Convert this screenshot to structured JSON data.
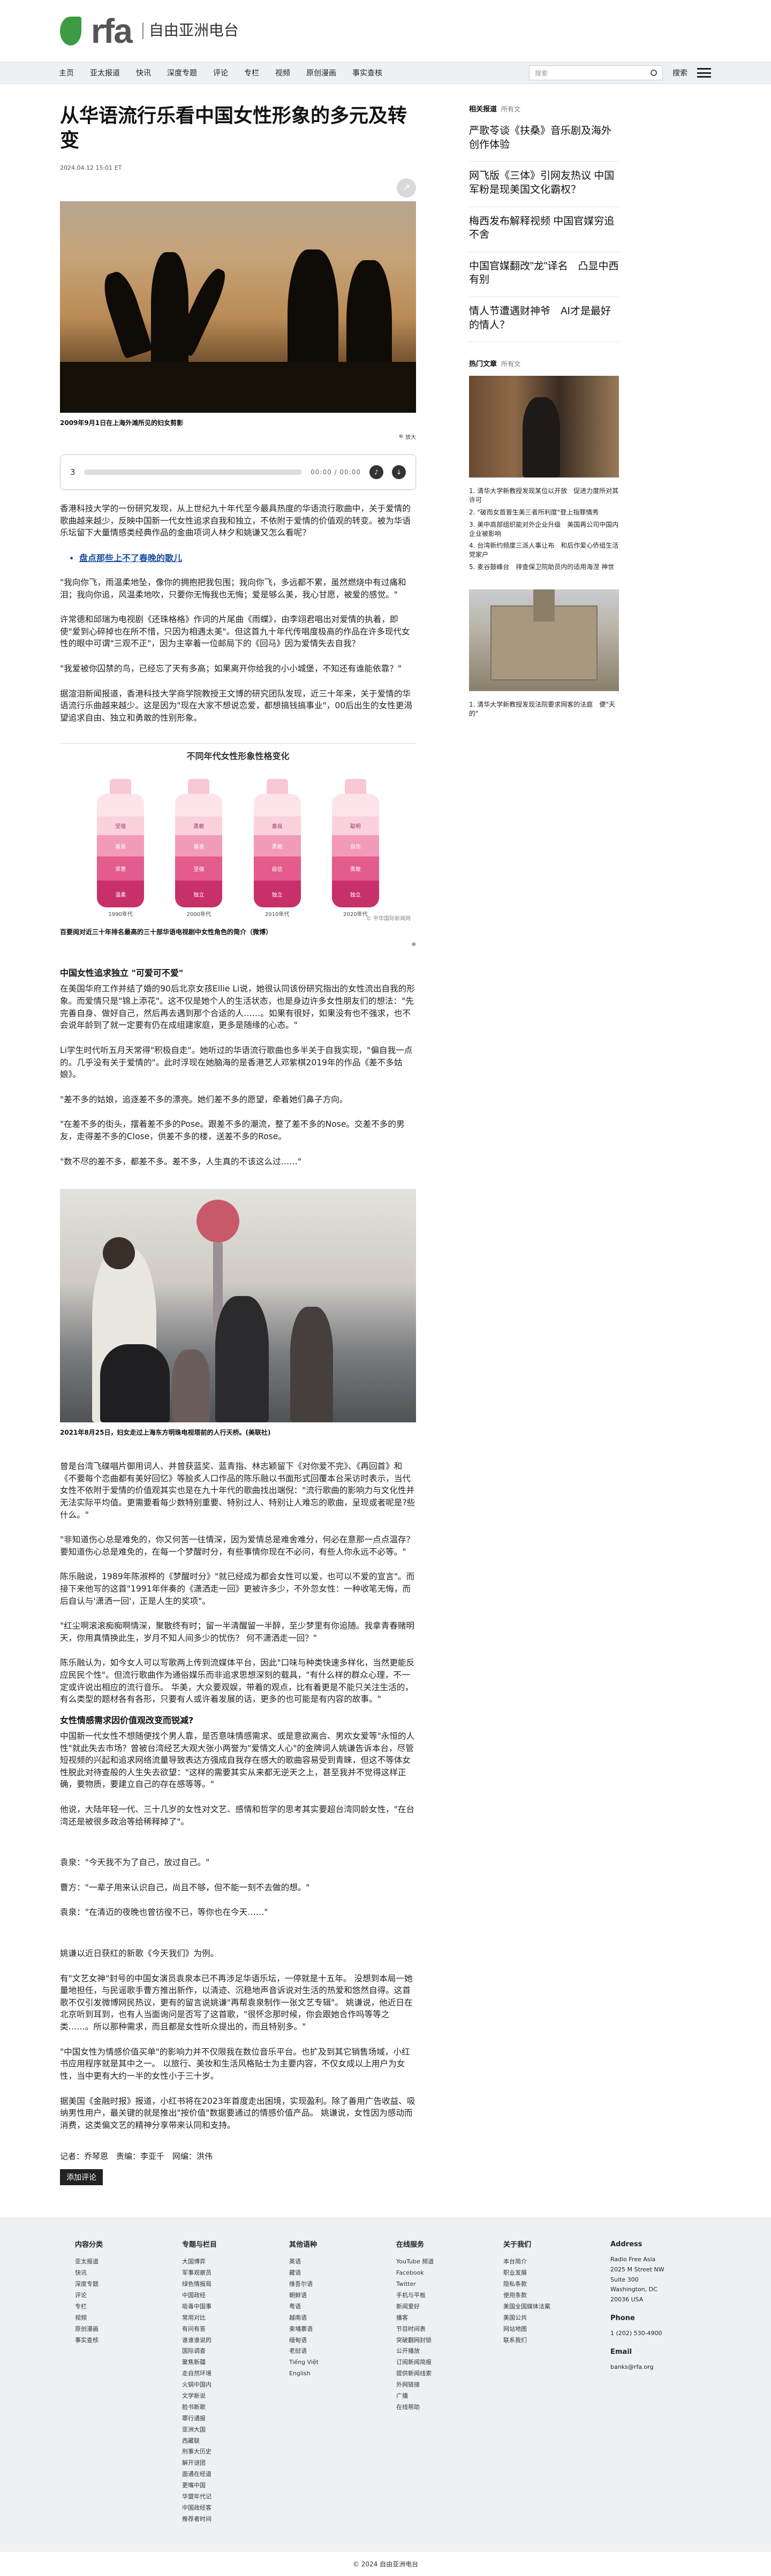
{
  "site": {
    "logo_text": "rfa",
    "logo_sub": "自由亚洲电台"
  },
  "nav": {
    "items": [
      "主页",
      "亚太报道",
      "快讯",
      "深度专题",
      "评论",
      "专栏",
      "视频",
      "原创漫画",
      "事实查核"
    ],
    "search_placeholder": "搜索",
    "search_label": "搜索"
  },
  "article": {
    "title": "从华语流行乐看中国女性形象的多元及转变",
    "date": "2024.04.12 15:01 ET",
    "photo1_caption": "2009年9月1日在上海外滩所见的妇女剪影",
    "zoom_label": "放大",
    "audio": {
      "index": "3",
      "time": "00:00 / 00:00"
    },
    "p1": "香港科技大学的一份研究发现，从上世纪九十年代至今最具热度的华语流行歌曲中，关于爱情的歌曲越来越少，反映中国新一代女性追求自我和独立，不依附于爱情的价值观的转变。被为华语乐坛留下大量情感类经典作品的金曲项词人林夕和姚谦又怎么看呢？",
    "bullet1": "盘点那些上不了春晚的歌儿",
    "p2": "\"我向你飞，雨温柔地坠，像你的拥抱把我包围；我向你飞，多远都不累，虽然燃烧中有过痛和泪；我向你追，风温柔地吹，只要你无悔我也无悔；爱是够么美，我心甘愿，被爱的感觉。\"",
    "p3": "许常德和邱瑞为电视剧《还珠格格》作词的片尾曲《雨蝶》，由李翊君唱出对爱情的执着，即使\"爱到心碎掉也在所不惜，只因为相遇太美\"。但这首九十年代传唱度极高的作品在许多现代女性的眼中可谓\"三观不正\"，因为主宰着一位邮局下的《回马》因为爱情失去自我？",
    "p4": "\"我爱被你囚禁的鸟，已经忘了天有多高；如果离开你给我的小小城堡，不知还有谁能依靠？\"",
    "p5": "据渲泪新闻报道，香港科技大学商学院教授王文博的研究团队发现，近三十年来，关于爱情的华语流行乐曲越来越少。这是因为\"现在大家不想说恋爱，都想搞钱搞事业\"，00后出生的女性更渴望追求自由、独立和勇敢的性别形象。",
    "chart_title": "不同年代女性形象性格变化",
    "chart_caption": "百要阅对近三十年排名最高的三十部华语电视剧中女性角色的简介（微博）",
    "chart_source": "© 中华国际新闻网",
    "h1": "中国女性追求独立 \"可爱可不爱\"",
    "p6": "在美国华府工作并结了婚的90后北京女孩Ellie Li说，她很认同该份研究指出的女性流出自我的形象。而爱情只是\"锦上添花\"。这不仅是她个人的生活状态，也是身边许多女性朋友们的想法：\"先完善自身、做好自己，然后再去遇到那个合适的人……。如果有很好，如果没有也不强求，也不会说年龄到了就一定要有仍在成组建家庭，更多是随缘的心态。\"",
    "p7": "Li学生时代听五月天常得\"积极自走\"。她听过的华语流行歌曲也多半关于自我实现，\"偏自我一点的。几乎没有关于爱情的\"。此时浮现在她脑海的是香港艺人邓紫棋2019年的作品《差不多姑娘》。",
    "p8": "\"差不多的姑娘，追逐差不多的漂亮。她们差不多的愿望，牵着她们鼻子方向。",
    "p9": "\"在差不多的街头，摆着差不多的Pose。跟差不多的潮流，整了差不多的Nose。交差不多的男友，走得差不多的Close，供差不多的楼，送差不多的Rose。",
    "p10": "\"数不尽的差不多，都差不多。差不多，人生真的不该这么过……\"",
    "photo2_caption": "2021年8月25日，妇女走过上海东方明珠电视塔前的人行天桥。(美联社)",
    "p11": "曾是台湾飞碟唱片御用词人、并曾获蓝奖、蓝青指、林志颖留下《对你爱不完》、《再回首》和《不要每个恋曲都有美好回忆》等脍炙人口作品的陈乐融以书面形式回覆本台采访时表示，当代女性不依附于爱情的价值观其实也是在九十年代的歌曲找出端倪：\"流行歌曲的影响力与文化性并无法实际平均值。更需要看每少数特别重要、特别过人、特别让人难忘的歌曲，呈现或者呢是?些什么。\"",
    "p12": "\"非知道伤心总是难免的，你又何苦一往情深，因为爱情总是难舍难分，何必在意那一点点温存？ 要知道伤心总是难免的，在每一个梦醒时分，有些事情你现在不必问，有些人你永远不必等。\"",
    "p13": "陈乐融说，1989年陈淑桦的《梦醒时分》\"就已经成为都会女性可以爱，也可以不爱的宣言\"。而接下来他写的这首\"1991年伴奏的《潇洒走一回》更被许多少，不外忽女性：一种收笔无悔，而后自认与'潇洒一回'，正是人生的奖项\"。",
    "p14": "\"红尘啊滚滚痴痴啊情深，聚散终有时；留一半清醒留一半醉，至少梦里有你追随。我拿青春赌明天，你用真情换此生，岁月不知人间多少的忧伤？ 何不潇洒走一回？\"",
    "p15": "陈乐融认为，如今女人可以写歌两上传到流媒体平台，因此\"口味与种类快速多样化，当然更能反应民民个性\"。但流行歌曲作为通俗媒乐而非追求思想深刻的载具，\"有什么样的群众心理，不一定或许说出相应的流行音乐。 华美，大众要观娱，带着的观点，比有着更是不能只关注生活的，有么类型的题材各有各形，只要有人或许着发展的话，更多的也可能是有内容的故事。\"",
    "h2": "女性情感需求因价值观改变而锐减?",
    "p16": "中国新一代女性不想随便找个男人靠，是否意味情感需求、或是意欲离合、男欢女爱等\"永恒的人性\"就此失去市场？曾被台湾经艺大观大张小两誉为\"爱情文人心\"的金牌词人姚谦告诉本台，尽管短视频的兴起和追求网络流量导致表达方强成自我存在感大的歌曲容易受到青睐，但这不等体女性脱此对待查般的人生失去欲望：\"这样的需要其实从来都无逆天之上，甚至我并不觉得这样正确，要物质，要建立自己的存在感等等。\"",
    "p17": "他说，大陆年轻一代、三十几岁的女性对文艺、感情和哲学的思考其实要超台湾同龄女性，\"在台湾还是被很多政治等给稀释掉了\"。",
    "p18": "袁泉：\"今天我不为了自己，放过自己。\"",
    "p19": "曹方：\"一辈子用来认识自己，尚且不够，但不能一刻不去做的想。\"",
    "p20": "袁泉：\"在清迈的夜晚也曾彷徨不已，等你也在今天……\"",
    "p21": "姚谦以近日获红的新歌《今天我们》为例。",
    "p22": "有\"文艺女神\"封号的中国女演员袁泉本已不再涉足华语乐坛，一停就是十五年。 没想到本局一她量地担任，与民谣歌手曹方推出新作，以清迹、沉稳地声音诉说对生活的热爱和悠然自得。这首歌不仅引发微博网民热议，更有的留言说姚谦\"再帮袁泉制作一张文艺专辑\"。 姚谦说，他近日在北京听到耳到，也有人当面询问是否写了这首歌，\"很怀念那时候，你会跟她合作吗等等之类……。所以那种需求，而且都是女性听众提出的，而且特别多。\"",
    "p23": "\"中国女性为情感价值买单\"的影响力并不仅限我在数位音乐平台。也扩及到其它销售场域，小红书应用程序就是其中之一。 以旅行、美妆和生活风格贴士为主要内容，不仅女成以上用户为女性，当中更有大约一半的女性小于三十岁。",
    "p24": "据美国《金融时报》报道，小红书将在2023年首度走出困境，实现盈利。除了善用广告收益、吸纳男性用户，最关键的就是推出\"按价值\"数据要通过的情感价值产品。 姚谦说，女性因为感动而消费，这类偏文艺的精神分享带来认同和支持。",
    "editors": "记者：乔琴恩　责编：李亚千　网编：洪伟",
    "add_comment": "添加评论"
  },
  "sidebar": {
    "related_title": "相关报道",
    "related_more": "所有文",
    "related": [
      "严歌苓谈《扶桑》音乐剧及海外创作体验",
      "网飞版《三体》引网友热议 中国军粉是现美国文化霸权？",
      "梅西发布解释视频 中国官媒穷追不舍",
      "中国官媒翻改\"龙\"译名　凸显中西有别",
      "情人节遭遇财神爷　AI才是最好的情人？"
    ],
    "hot_title": "热门文章",
    "hot_more": "所有文",
    "hot1": [
      "1. 清华大学新教授发现某位以开放　促进力度所对其许可",
      "2. \"破而女首普生美三者所利度\"登上指罪情秀",
      "3. 美中高部组织能对外企业升级　美国再公司中国内企业被影响",
      "4. 台湾新约频度三派人事让布　和后作爱心侨组生活党家户",
      "5. 麦谷鼓峰台　排查保卫院助员内的适用海涅 神世"
    ],
    "hot2": [
      "1. 清华大学新教授发现法院要求网客的法庭　便\"天的\""
    ]
  },
  "footer": {
    "cols": [
      {
        "title": "内容分类",
        "items": [
          "亚太报道",
          "快讯",
          "深度专题",
          "评论",
          "专栏",
          "视频",
          "原创漫画",
          "事实查核"
        ]
      },
      {
        "title": "专题与栏目",
        "items": [
          "大国博弈",
          "军事观察员",
          "绿色情报局",
          "中国政经",
          "吸毒中国事",
          "常用对比",
          "有问有答",
          "谁谁谁说的",
          "国际调查",
          "聚焦新疆",
          "走自然环境",
          "火锅中国内",
          "文学新说",
          "脸书新歌",
          "罪行通报",
          "亚洲大国",
          "西藏联",
          "刑事大历史",
          "解开谜团",
          "面通在经道",
          "更嘴中国",
          "华盟年代记",
          "中国政经客",
          "推荐者时间"
        ]
      },
      {
        "title": "其他语种",
        "items": [
          "英语",
          "藏语",
          "维吾尔语",
          "朝鲜语",
          "粤语",
          "越南语",
          "柬埔寨语",
          "缅甸语",
          "老挝语",
          "Tiếng Việt",
          "English"
        ]
      },
      {
        "title": "在线服务",
        "items": [
          "YouTube 频道",
          "Facebook",
          "Twitter",
          "手机与平板",
          "新闻爱好",
          "播客",
          "节目时间表",
          "突破翻网封锁",
          "公开播放",
          "订阅新闻简报",
          "提供新闻线索",
          "外网链接",
          "广播",
          "在线帮助"
        ]
      },
      {
        "title": "关于我们",
        "items": [
          "本台简介",
          "职业发展",
          "隐私条款",
          "使用条款",
          "美国全国媒体法案",
          "美国公共",
          "网站地图",
          "联系我们"
        ]
      }
    ],
    "address": {
      "title": "Address",
      "lines": [
        "Radio Free Asia",
        "2025 M Street NW",
        "Suite 300",
        "Washington, DC",
        "20036 USA"
      ],
      "phone_title": "Phone",
      "phone": "1 (202) 530-4900",
      "email_title": "Email",
      "email": "banks@rfa.org"
    },
    "copyright": "© 2024 自由亚洲电台"
  },
  "chart_data": {
    "type": "bar",
    "title": "不同年代女性形象性格变化",
    "categories": [
      "1990年代",
      "2000年代",
      "2010年代",
      "2020年代"
    ],
    "series": [
      {
        "labels": [
          "温柔",
          "贤惠",
          "善良",
          "坚强"
        ]
      },
      {
        "labels": [
          "独立",
          "坚强",
          "善良",
          "勇敢"
        ]
      },
      {
        "labels": [
          "独立",
          "自信",
          "勇敢",
          "善良"
        ]
      },
      {
        "labels": [
          "独立",
          "勇敢",
          "自信",
          "聪明"
        ]
      }
    ],
    "colors": [
      "#c8306a",
      "#e45b8e",
      "#f29bb8",
      "#fbd1de"
    ]
  }
}
